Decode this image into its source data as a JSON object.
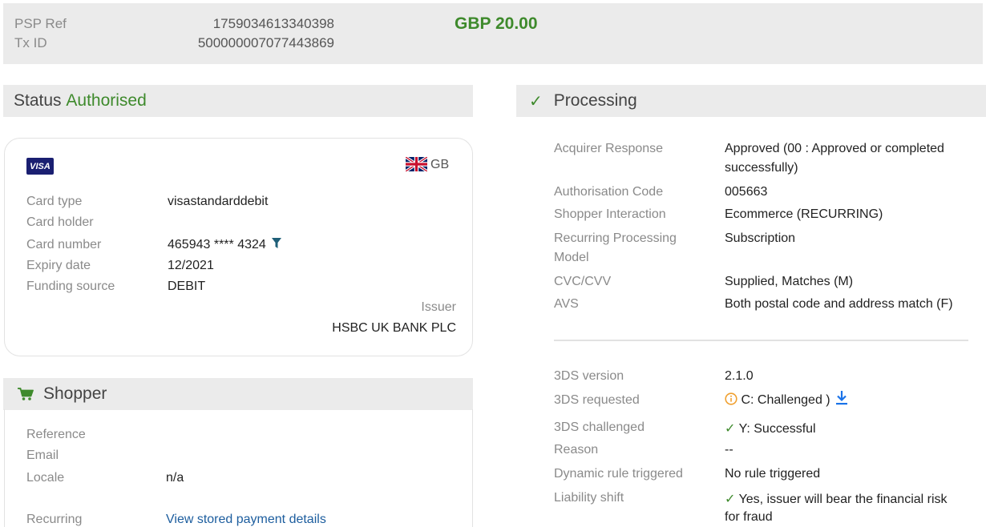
{
  "header": {
    "psp_ref_label": "PSP Ref",
    "psp_ref_value": "1759034613340398",
    "tx_id_label": "Tx ID",
    "tx_id_value": "500000007077443869",
    "amount": "GBP 20.00"
  },
  "status": {
    "label": "Status",
    "value": "Authorised"
  },
  "card": {
    "brand": "VISA",
    "country": "GB",
    "rows": [
      {
        "label": "Card type",
        "value": "visastandarddebit"
      },
      {
        "label": "Card holder",
        "value": ""
      },
      {
        "label": "Card number",
        "value": "465943 **** 4324"
      },
      {
        "label": "Expiry date",
        "value": "12/2021"
      },
      {
        "label": "Funding source",
        "value": "DEBIT"
      }
    ],
    "issuer_label": "Issuer",
    "issuer_value": "HSBC UK BANK PLC"
  },
  "shopper": {
    "title": "Shopper",
    "rows": [
      {
        "label": "Reference",
        "value": ""
      },
      {
        "label": "Email",
        "value": ""
      },
      {
        "label": "Locale",
        "value": "n/a"
      },
      {
        "label": "Recurring",
        "value": "View stored payment details"
      }
    ]
  },
  "processing": {
    "title": "Processing",
    "acquirer_response_label": "Acquirer Response",
    "acquirer_response_line1": "Approved (00 : Approved or completed",
    "acquirer_response_line2": "successfully)",
    "auth_code_label": "Authorisation Code",
    "auth_code_value": "005663",
    "shopper_interaction_label": "Shopper Interaction",
    "shopper_interaction_value": "Ecommerce (RECURRING)",
    "recurring_model_label_line1": "Recurring Processing",
    "recurring_model_label_line2": "Model",
    "recurring_model_value": "Subscription",
    "cvc_label": "CVC/CVV",
    "cvc_value": "Supplied, Matches (M)",
    "avs_label": "AVS",
    "avs_value": "Both postal code and address match (F)",
    "tds_version_label": "3DS version",
    "tds_version_value": "2.1.0",
    "tds_requested_label": "3DS requested",
    "tds_requested_value": "C: Challenged )",
    "tds_challenged_label": "3DS challenged",
    "tds_challenged_value": "Y: Successful",
    "reason_label": "Reason",
    "reason_value": "--",
    "dynamic_rule_label": "Dynamic rule triggered",
    "dynamic_rule_value": "No rule triggered",
    "liability_label": "Liability shift",
    "liability_value_line1": "Yes, issuer will bear the financial risk",
    "liability_value_line2": "for fraud"
  },
  "colors": {
    "accent_green": "#3e8a2c",
    "link_blue": "#1c5d9e",
    "warning_orange": "#f0a030",
    "panel_grey": "#ebebeb"
  }
}
